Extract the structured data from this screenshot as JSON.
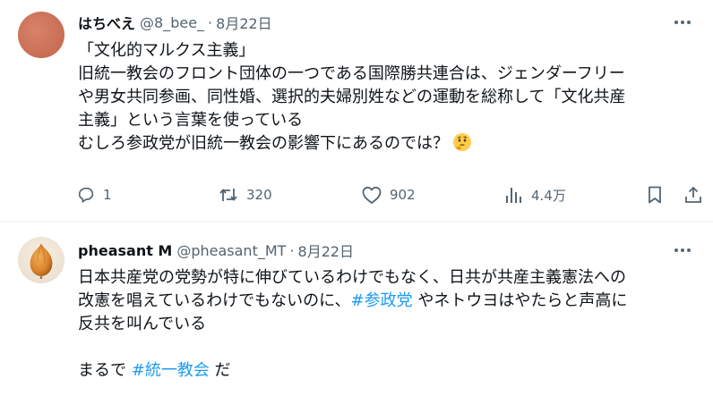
{
  "tweets": [
    {
      "name": "はちべえ",
      "handle": "@8_bee_",
      "separator": "·",
      "date": "8月22日",
      "lines": [
        "「文化的マルクス主義」",
        "旧統一教会のフロント団体の一つである国際勝共連合は、ジェンダーフリー",
        "や男女共同参画、同性婚、選択的夫婦別姓などの運動を総称して「文化共産",
        "主義」という言葉を使っている",
        "むしろ参政党が旧統一教会の影響下にあるのでは？"
      ],
      "emoji_name": "thinking-face-emoji",
      "actions": {
        "replies": "1",
        "retweets": "320",
        "likes": "902",
        "views": "4.4万"
      }
    },
    {
      "name": "pheasant M",
      "handle": "@pheasant_MT",
      "separator": "·",
      "date": "8月22日",
      "line1": "日本共産党の党勢が特に伸びているわけでもなく、日共が共産主義憲法への",
      "line2": "改憲を唱えているわけでもないのに、",
      "hashtag1": "#参政党",
      "line2_after": " やネトウヨはやたらと声高に",
      "line3": "反共を叫んでいる",
      "line5_before": "まるで ",
      "hashtag2": "#統一教会",
      "line5_after": " だ"
    }
  ],
  "colors": {
    "text": "#0f1419",
    "secondary": "#536471",
    "link": "#1d9bf0",
    "divider": "#eff3f4"
  },
  "icons": [
    "more-icon",
    "reply-icon",
    "retweet-icon",
    "like-icon",
    "views-icon",
    "bookmark-icon",
    "share-icon"
  ]
}
